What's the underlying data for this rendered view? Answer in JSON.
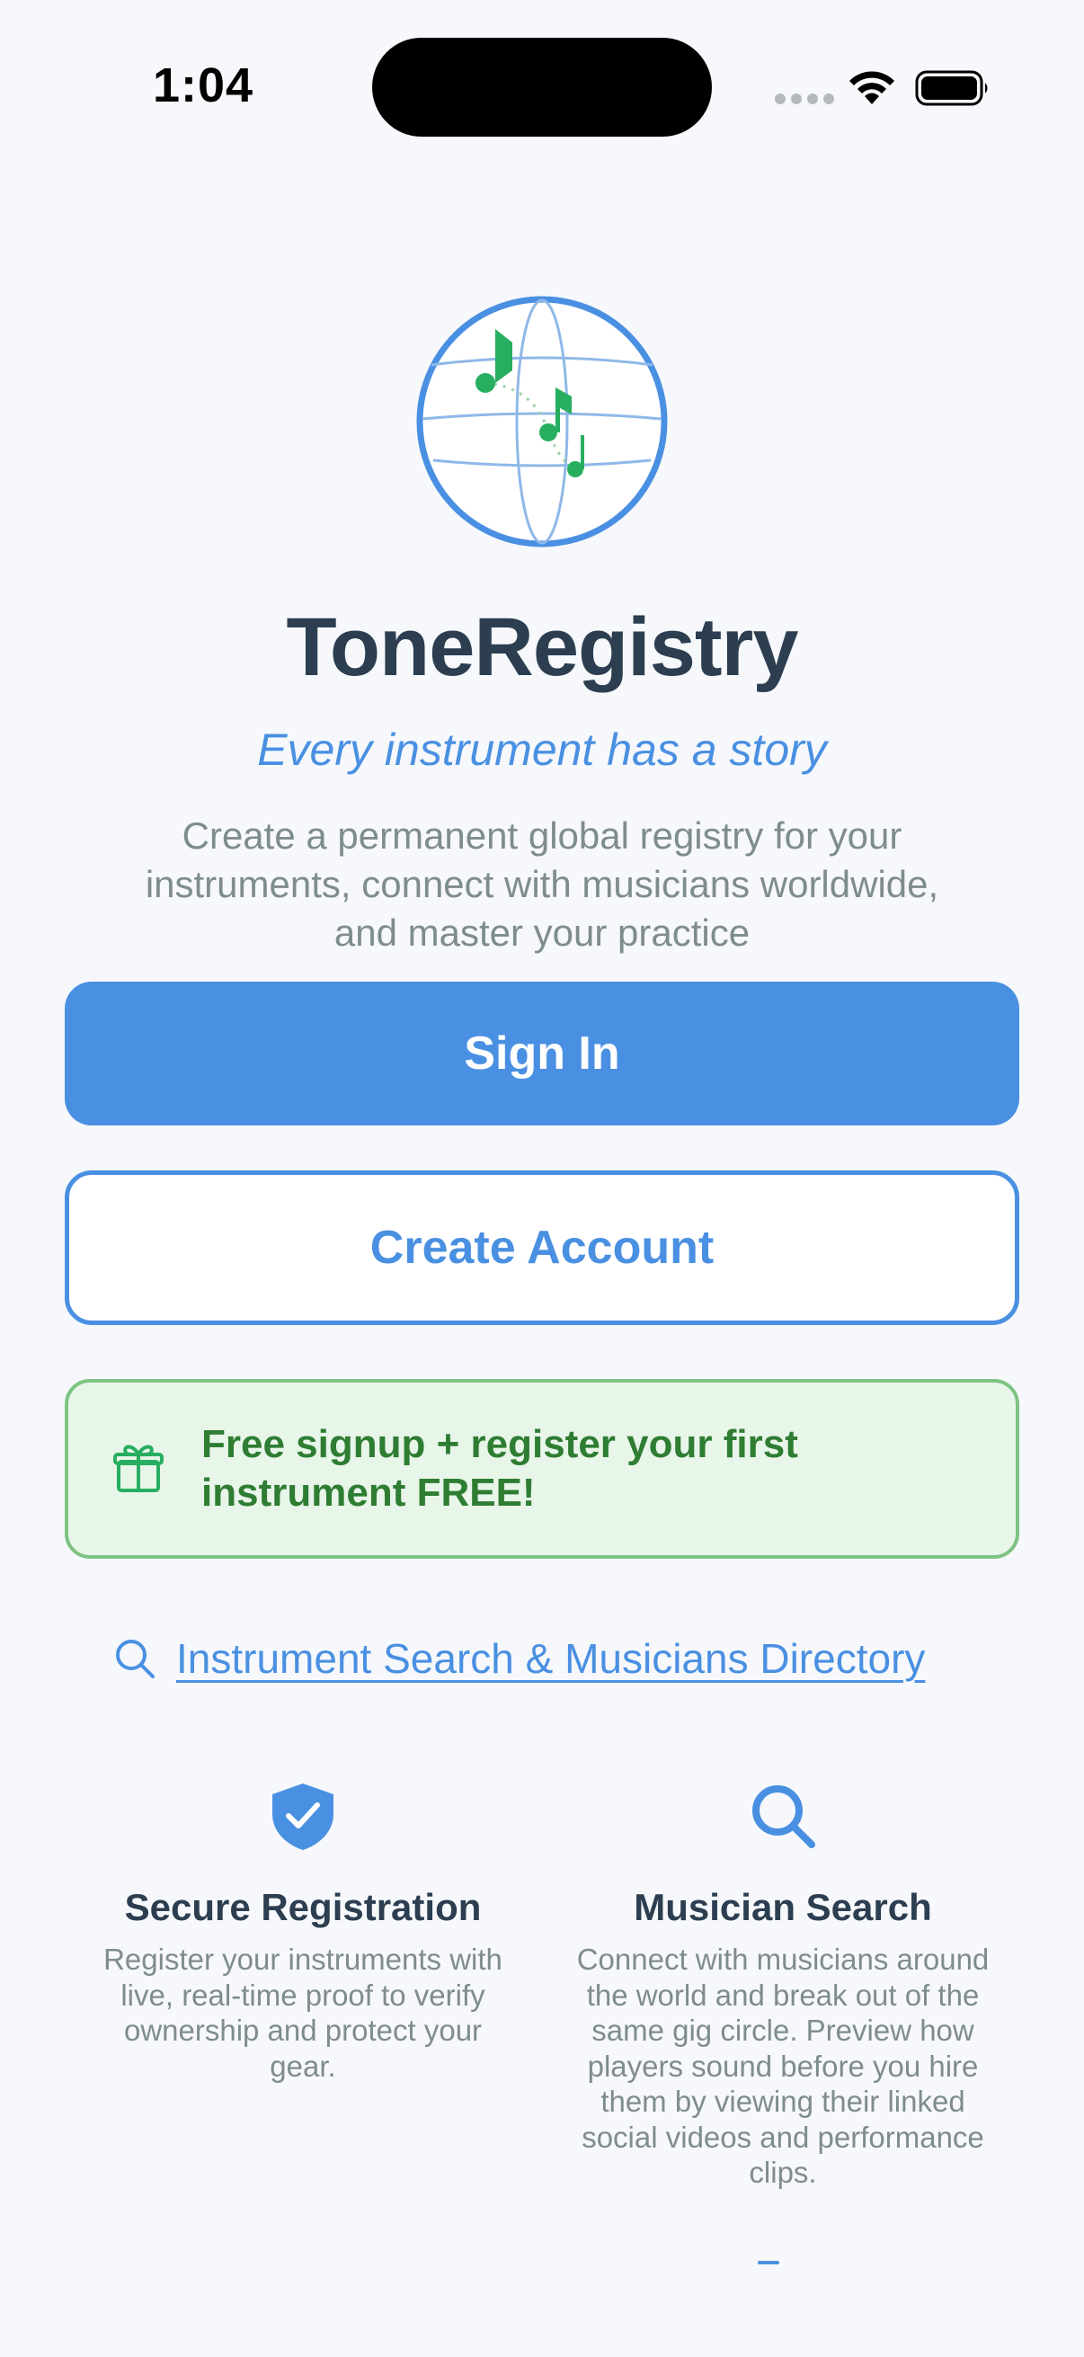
{
  "status_bar": {
    "time": "1:04"
  },
  "app": {
    "title": "ToneRegistry",
    "tagline": "Every instrument has a story",
    "description": "Create a permanent global registry for your instruments, connect with musicians worldwide, and master your practice",
    "logo_icon": "globe-music-notes-icon"
  },
  "buttons": {
    "sign_in": "Sign In",
    "create_account": "Create Account"
  },
  "promo": {
    "icon": "gift-icon",
    "text": "Free signup + register your first instrument FREE!"
  },
  "directory_link": {
    "icon": "search-icon",
    "label": "Instrument Search & Musicians Directory"
  },
  "features": [
    {
      "icon": "shield-check-icon",
      "title": "Secure Registration",
      "description": "Register your instruments with live, real-time proof to verify ownership and protect your gear."
    },
    {
      "icon": "search-icon",
      "title": "Musician Search",
      "description": "Connect with musicians around the world and break out of the same gig circle. Preview how players sound before you hire them by viewing their linked social videos and performance clips."
    }
  ],
  "colors": {
    "primary": "#4a90e2",
    "title": "#2c3e50",
    "muted": "#7f8c8d",
    "promo_bg": "#e8f5e9",
    "promo_border": "#7dc383",
    "promo_text": "#2e7d32",
    "note_green": "#27ae60",
    "background": "#f6f8fb"
  }
}
